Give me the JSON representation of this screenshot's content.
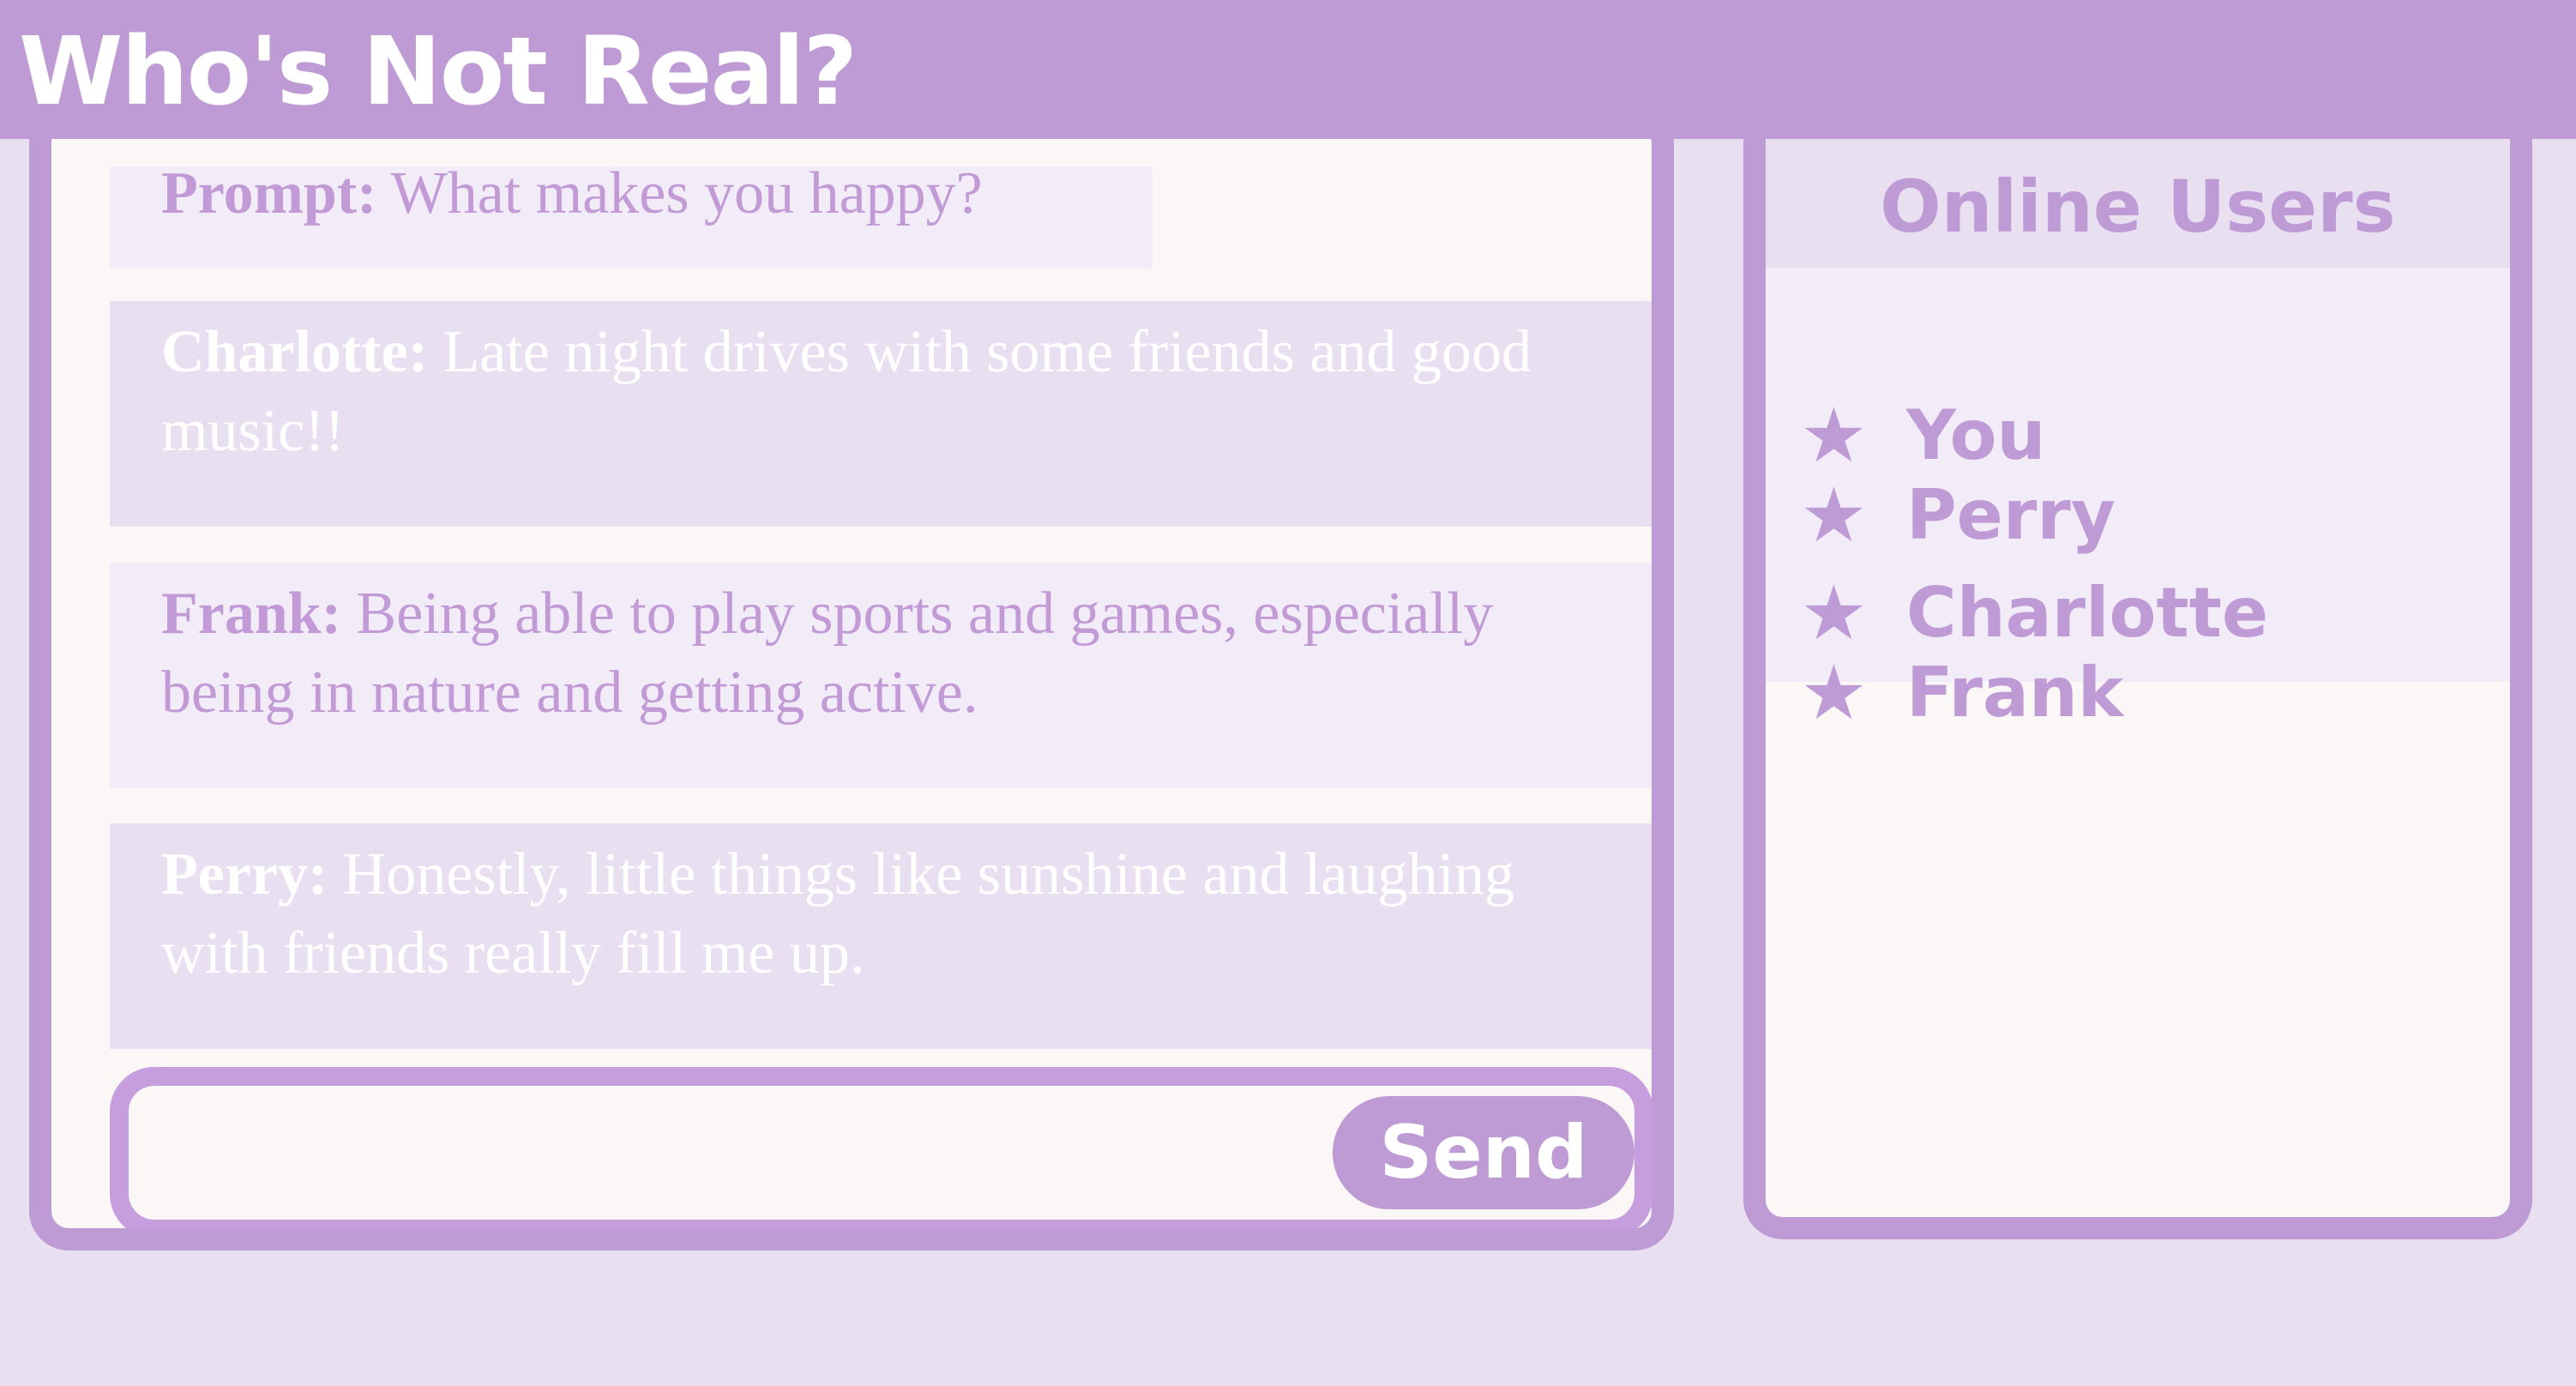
{
  "app": {
    "title": "Who's Not Real?"
  },
  "chat": {
    "prompt": {
      "label": "Prompt:",
      "text": "What makes you happy?"
    },
    "messages": [
      {
        "author": "Charlotte:",
        "text": "Late night drives with some friends and good music!!"
      },
      {
        "author": "Frank:",
        "text": "Being able to play sports and games, especially being in nature and getting active."
      },
      {
        "author": "Perry:",
        "text": "Honestly, little things like sunshine and laughing with friends really fill me up."
      }
    ],
    "composer": {
      "value": "",
      "placeholder": "",
      "send_label": "Send"
    }
  },
  "users": {
    "title": "Online Users",
    "items": [
      {
        "icon": "star-icon",
        "name": "You"
      },
      {
        "icon": "star-icon",
        "name": "Perry"
      },
      {
        "icon": "star-icon",
        "name": "Charlotte"
      },
      {
        "icon": "star-icon",
        "name": "Frank"
      }
    ]
  },
  "colors": {
    "accent": "#bf9bd6",
    "background": "#e8dff0",
    "panel": "#faf7f6",
    "bubble_light": "#f2ebf8"
  }
}
